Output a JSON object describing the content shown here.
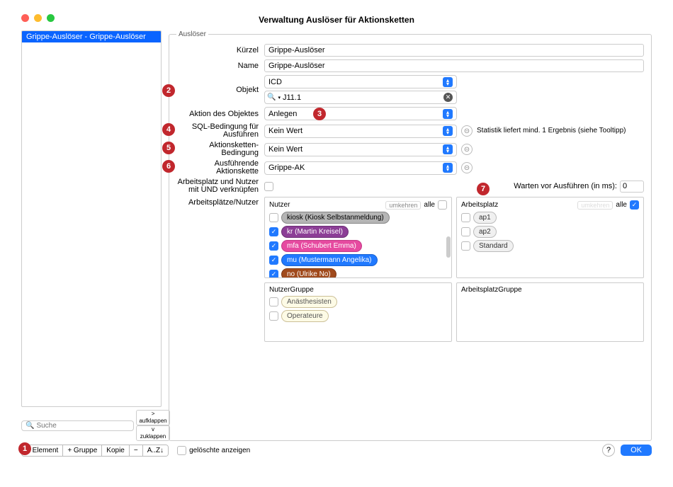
{
  "window": {
    "title": "Verwaltung Auslöser für Aktionsketten"
  },
  "sidebar": {
    "item": "Grippe-Auslöser - Grippe-Auslöser",
    "search_placeholder": "Suche",
    "btn_expand": "> aufklappen",
    "btn_collapse": "v zuklappen"
  },
  "form": {
    "legend": "Auslöser",
    "labels": {
      "kuerzel": "Kürzel",
      "name": "Name",
      "objekt": "Objekt",
      "aktion": "Aktion des Objektes",
      "sql": "SQL-Bedingung für Ausführen",
      "akbed": "Aktionsketten-Bedingung",
      "ausf": "Ausführende Aktionskette",
      "apund": "Arbeitsplatz und Nutzer mit UND verknüpfen",
      "apnutzer": "Arbeitsplätze/Nutzer",
      "warten": "Warten vor Ausführen (in ms):"
    },
    "values": {
      "kuerzel": "Grippe-Auslöser",
      "name": "Grippe-Auslöser",
      "objekt": "ICD",
      "search": "J11.1",
      "aktion": "Anlegen",
      "sql": "Kein Wert",
      "akbed": "Kein Wert",
      "ausf": "Grippe-AK",
      "warten": "0"
    },
    "hint": "Statistik liefert mind. 1 Ergebnis (siehe Tooltipp)"
  },
  "panels": {
    "nutzer": {
      "title": "Nutzer",
      "btn_invert": "umkehren",
      "btn_all": "alle",
      "items": [
        {
          "label": "kiosk (Kiosk Selbstanmeldung)",
          "cls": "grey",
          "checked": false
        },
        {
          "label": "kr (Martin Kreisel)",
          "cls": "purple",
          "checked": true
        },
        {
          "label": "mfa (Schubert Emma)",
          "cls": "pink",
          "checked": true
        },
        {
          "label": "mu (Mustermann Angelika)",
          "cls": "blue",
          "checked": true
        },
        {
          "label": "no (Ulrike No)",
          "cls": "brown",
          "checked": true
        }
      ]
    },
    "arbeitsplatz": {
      "title": "Arbeitsplatz",
      "btn_invert": "umkehren",
      "btn_all": "alle",
      "items": [
        {
          "label": "ap1"
        },
        {
          "label": "ap2"
        },
        {
          "label": "Standard"
        }
      ]
    },
    "nutzergruppe": {
      "title": "NutzerGruppe",
      "items": [
        {
          "label": "Anästhesisten"
        },
        {
          "label": "Operateure"
        }
      ]
    },
    "apgruppe": {
      "title": "ArbeitsplatzGruppe"
    }
  },
  "bottom": {
    "btn_element": "+ Element",
    "btn_gruppe": "+ Gruppe",
    "btn_kopie": "Kopie",
    "btn_minus": "−",
    "btn_sort": "A..Z↓",
    "deleted": "gelöschte anzeigen",
    "help": "?",
    "ok": "OK"
  },
  "badges": [
    "1",
    "2",
    "3",
    "4",
    "5",
    "6",
    "7"
  ]
}
